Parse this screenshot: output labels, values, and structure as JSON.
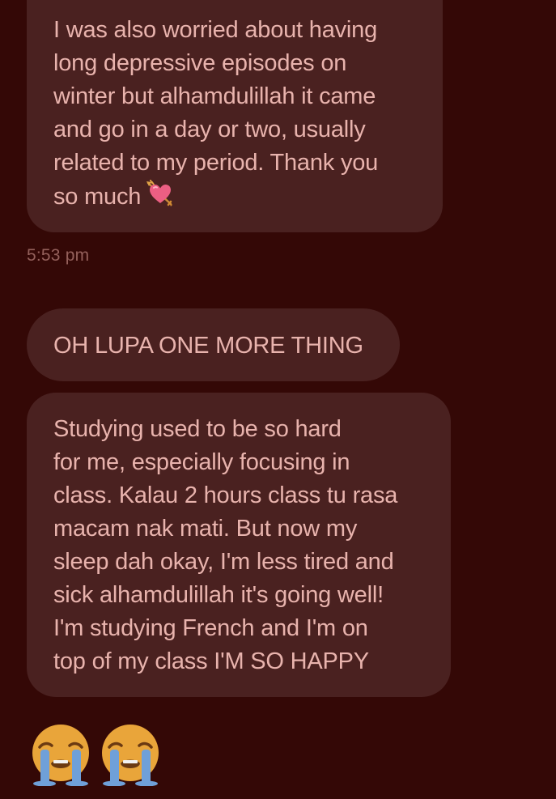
{
  "messages": [
    {
      "lines": [
        "I was also worried about having",
        "long depressive episodes on",
        "winter but alhamdulillah it came",
        "and go in a day or two, usually",
        "related to my period. Thank you",
        "so much"
      ],
      "trailing_emoji": "heart-with-arrow-icon"
    },
    {
      "lines": [
        "OH LUPA ONE MORE THING"
      ]
    },
    {
      "lines": [
        "Studying used to be so hard",
        "for me, especially focusing in",
        "class. Kalau 2 hours class tu rasa",
        "macam nak mati. But now my",
        "sleep dah okay, I'm less tired and",
        "sick alhamdulillah it's going well!",
        "I'm studying French and I'm on",
        "top of my class I'M SO HAPPY"
      ]
    }
  ],
  "timestamp": "5:53 pm",
  "emoji_message": [
    "loudly-crying-face-icon",
    "loudly-crying-face-icon"
  ],
  "colors": {
    "background": "#340806",
    "bubble": "#4a2120",
    "text": "#e8b3ad",
    "timestamp": "#94605b"
  }
}
